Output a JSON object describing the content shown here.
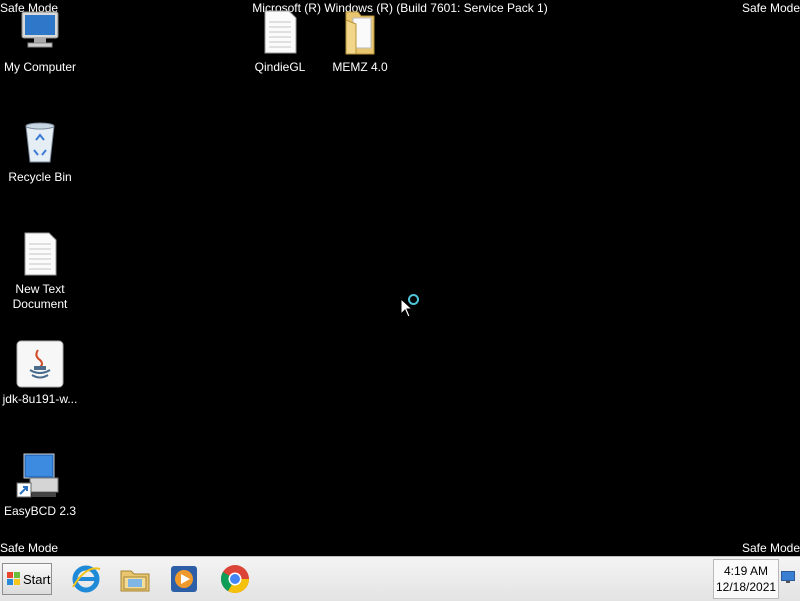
{
  "banner": {
    "safe_mode": "Safe Mode",
    "build": "Microsoft (R) Windows (R) (Build 7601: Service Pack 1)"
  },
  "desktop_icons": [
    {
      "label": "My Computer",
      "icon": "computer-icon"
    },
    {
      "label": "Recycle Bin",
      "icon": "recycle-bin-icon"
    },
    {
      "label": "New Text Document",
      "icon": "text-document-icon"
    },
    {
      "label": "jdk-8u191-w...",
      "icon": "java-icon"
    },
    {
      "label": "EasyBCD 2.3",
      "icon": "easybcd-icon"
    },
    {
      "label": "QindieGL",
      "icon": "document-icon"
    },
    {
      "label": "MEMZ 4.0",
      "icon": "folder-icon"
    }
  ],
  "taskbar": {
    "start_label": "Start",
    "pinned": [
      "internet-explorer-icon",
      "file-explorer-icon",
      "media-player-icon",
      "chrome-icon"
    ],
    "clock_time": "4:19 AM",
    "clock_date": "12/18/2021"
  },
  "colors": {
    "desktop_bg": "#000000",
    "taskbar_bg": "#ececec",
    "busy_ring": "#4fc3d8"
  }
}
